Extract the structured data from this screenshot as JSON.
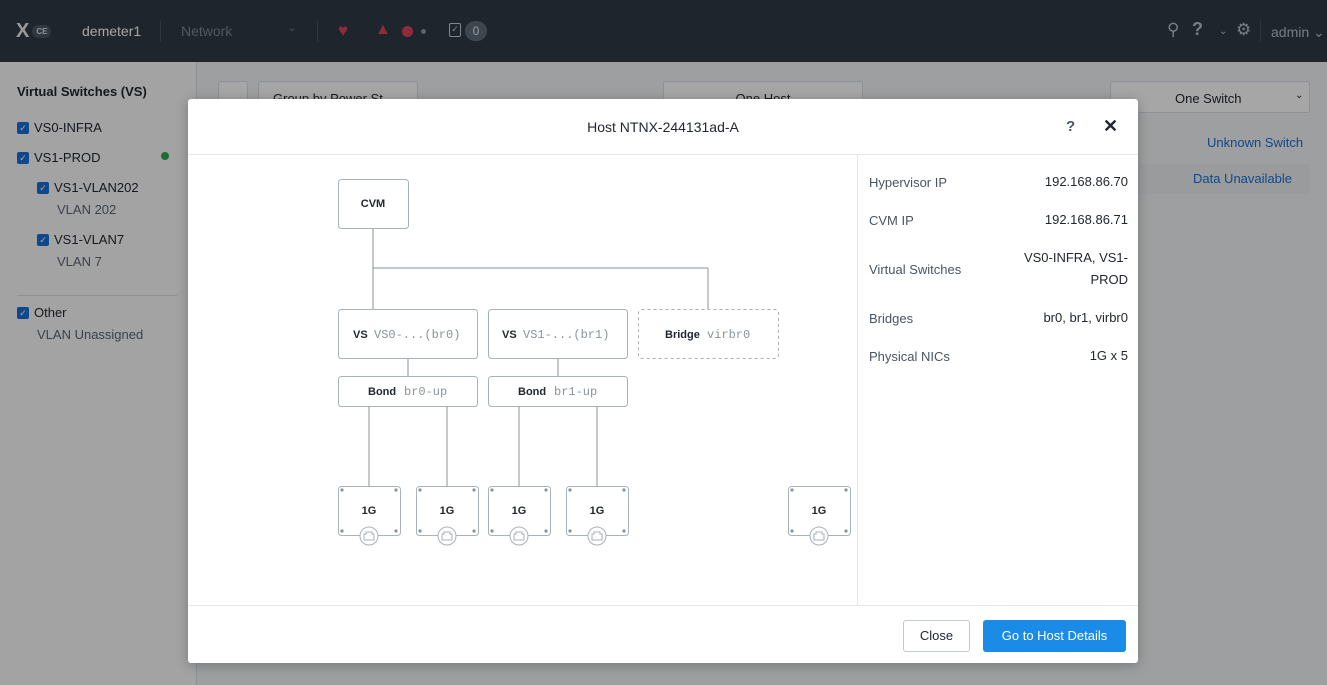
{
  "topbar": {
    "logo_mark": "X",
    "logo_badge": "CE",
    "cluster_name": "demeter1",
    "nav_value": "Network",
    "task_count": "0",
    "user": "admin"
  },
  "sidebar": {
    "title": "Virtual Switches (VS)",
    "items": [
      {
        "label": "VS0-INFRA"
      },
      {
        "label": "VS1-PROD"
      },
      {
        "label": "VS1-VLAN202",
        "sub": "VLAN 202"
      },
      {
        "label": "VS1-VLAN7",
        "sub": "VLAN 7"
      },
      {
        "label": "Other",
        "sub": "VLAN Unassigned"
      }
    ]
  },
  "background": {
    "group_by": "Group by Power St",
    "host_select": "One Host",
    "switch_select": "One Switch",
    "unknown_switch": "Unknown Switch",
    "data_unavailable": "Data Unavailable"
  },
  "modal": {
    "title": "Host NTNX-244131ad-A",
    "help": "?",
    "close_x": "✕",
    "diagram": {
      "cvm": "CVM",
      "switches": [
        {
          "kind": "VS",
          "name": "VS0-...(br0)"
        },
        {
          "kind": "VS",
          "name": "VS1-...(br1)"
        },
        {
          "kind": "Bridge",
          "name": "virbr0"
        }
      ],
      "bonds": [
        {
          "kind": "Bond",
          "name": "br0-up"
        },
        {
          "kind": "Bond",
          "name": "br1-up"
        }
      ],
      "nics": [
        "1G",
        "1G",
        "1G",
        "1G",
        "1G"
      ]
    },
    "properties": [
      {
        "label": "Hypervisor IP",
        "value": "192.168.86.70"
      },
      {
        "label": "CVM IP",
        "value": "192.168.86.71"
      },
      {
        "label": "Virtual Switches",
        "value": "VS0-INFRA, VS1-PROD"
      },
      {
        "label": "Bridges",
        "value": "br0, br1, virbr0"
      },
      {
        "label": "Physical NICs",
        "value": "1G x 5"
      }
    ],
    "footer": {
      "close_label": "Close",
      "primary_label": "Go to Host Details"
    }
  },
  "colors": {
    "primary": "#1b8be8",
    "topbar": "#313a46",
    "alert": "#d9445a",
    "status_ok": "#2fa84f"
  }
}
